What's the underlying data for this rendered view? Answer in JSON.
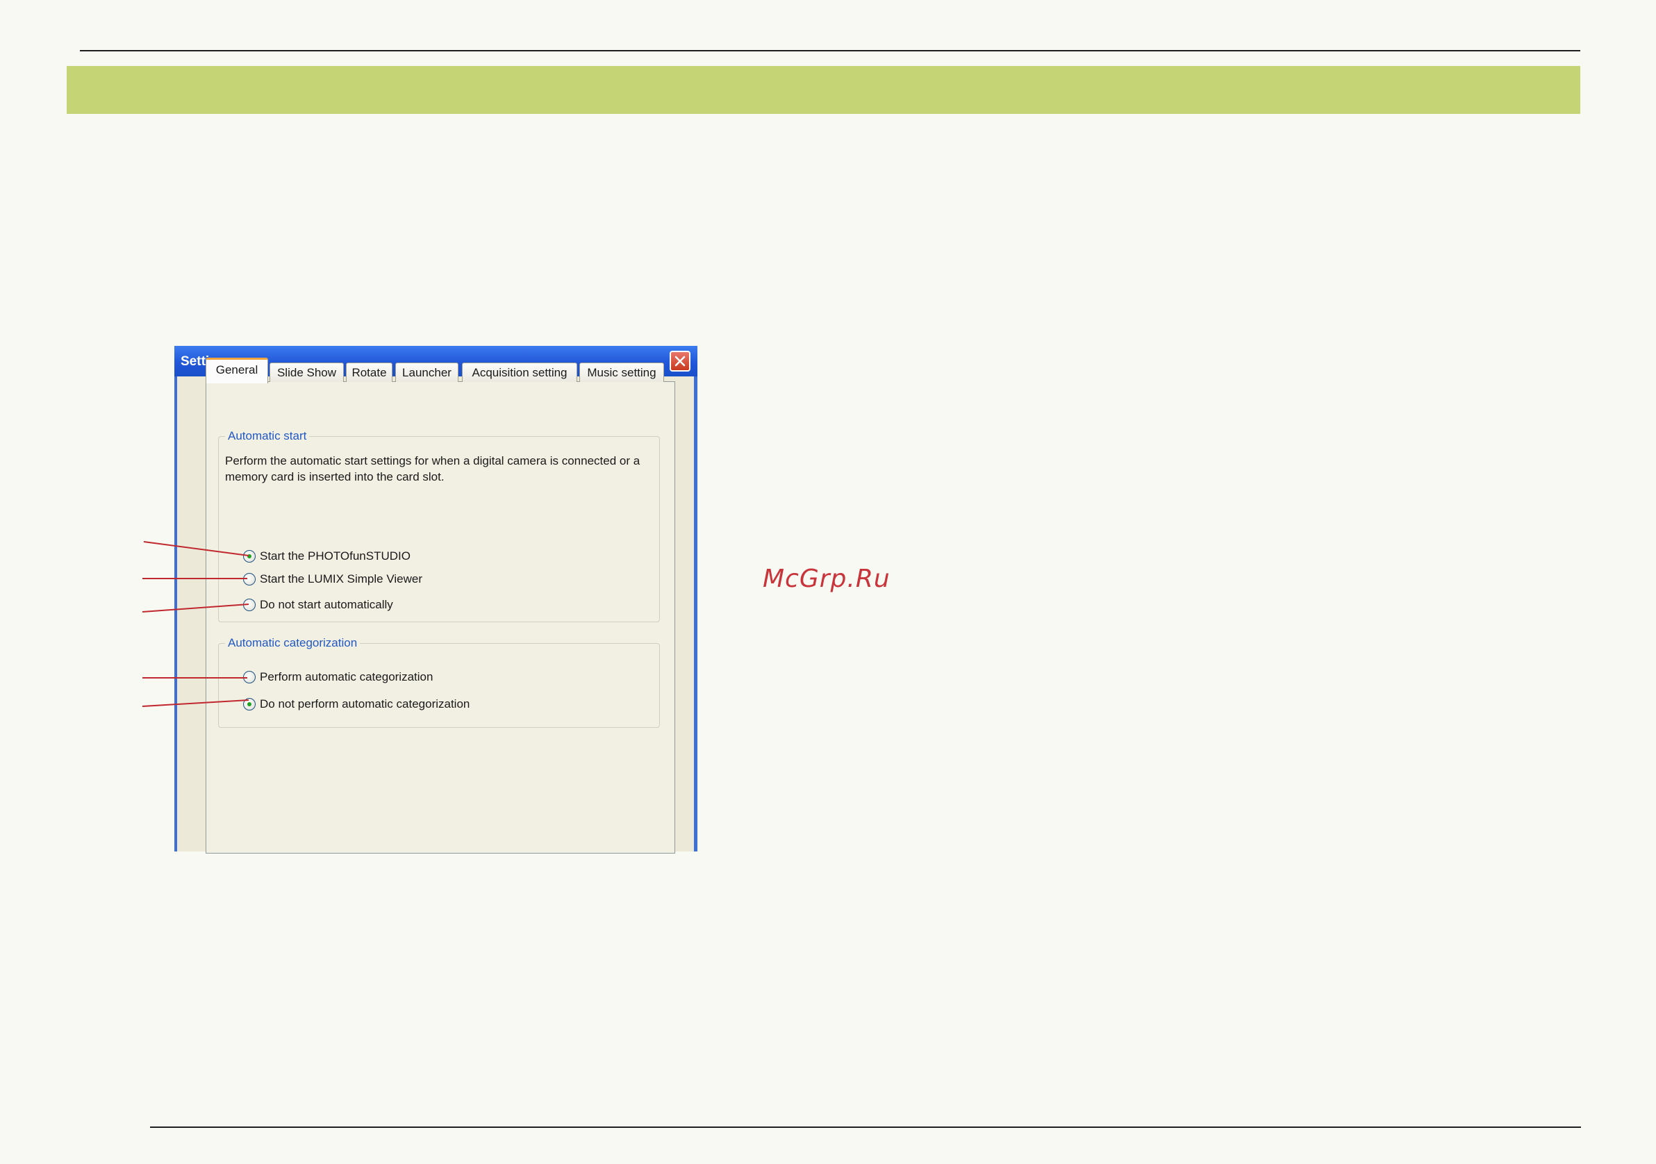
{
  "watermark": "McGrp.Ru",
  "window": {
    "title": "Settings",
    "close_icon": "close-icon"
  },
  "tabs": [
    {
      "label": "General",
      "active": true
    },
    {
      "label": "Slide Show",
      "active": false
    },
    {
      "label": "Rotate",
      "active": false
    },
    {
      "label": "Launcher",
      "active": false
    },
    {
      "label": "Acquisition setting",
      "active": false
    },
    {
      "label": "Music setting",
      "active": false
    }
  ],
  "automatic_start": {
    "legend": "Automatic start",
    "description": "Perform the automatic start settings for when a digital camera is connected or a memory card is inserted into the card slot.",
    "options": [
      {
        "label": "Start the PHOTOfunSTUDIO",
        "selected": true
      },
      {
        "label": "Start the LUMIX Simple Viewer",
        "selected": false
      },
      {
        "label": "Do not start automatically",
        "selected": false
      }
    ]
  },
  "automatic_categorization": {
    "legend": "Automatic categorization",
    "options": [
      {
        "label": "Perform automatic categorization",
        "selected": false
      },
      {
        "label": "Do not perform automatic categorization",
        "selected": true
      }
    ]
  },
  "colors": {
    "header_band": "#c5d474",
    "watermark": "#c8343a",
    "titlebar": "#2157d8",
    "legend_text": "#2159c4",
    "selected_radio_dot": "#21a121"
  }
}
